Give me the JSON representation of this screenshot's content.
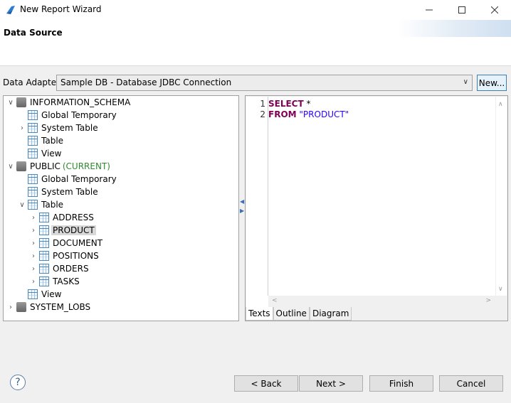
{
  "window": {
    "title": "New Report Wizard"
  },
  "header": {
    "title": "Data Source"
  },
  "adapter": {
    "label": "Data Adapter",
    "selected": "Sample DB - Database JDBC Connection",
    "new_label": "New..."
  },
  "tree": {
    "schemas": [
      {
        "name": "INFORMATION_SCHEMA",
        "children": [
          "Global Temporary",
          "System Table",
          "Table",
          "View"
        ]
      },
      {
        "name": "PUBLIC",
        "current": "(CURRENT)",
        "children": [
          "Global Temporary",
          "System Table",
          "Table",
          "View"
        ],
        "tables": [
          "ADDRESS",
          "PRODUCT",
          "DOCUMENT",
          "POSITIONS",
          "ORDERS",
          "TASKS"
        ]
      },
      {
        "name": "SYSTEM_LOBS"
      }
    ],
    "selected": "PRODUCT"
  },
  "editor": {
    "lines": [
      {
        "num": "1",
        "kw": "SELECT",
        "rest": " *"
      },
      {
        "num": "2",
        "kw": "FROM",
        "rest": " \"PRODUCT\""
      }
    ],
    "tabs": [
      "Texts",
      "Outline",
      "Diagram"
    ]
  },
  "buttons": {
    "back": "< Back",
    "next": "Next >",
    "finish": "Finish",
    "cancel": "Cancel"
  }
}
